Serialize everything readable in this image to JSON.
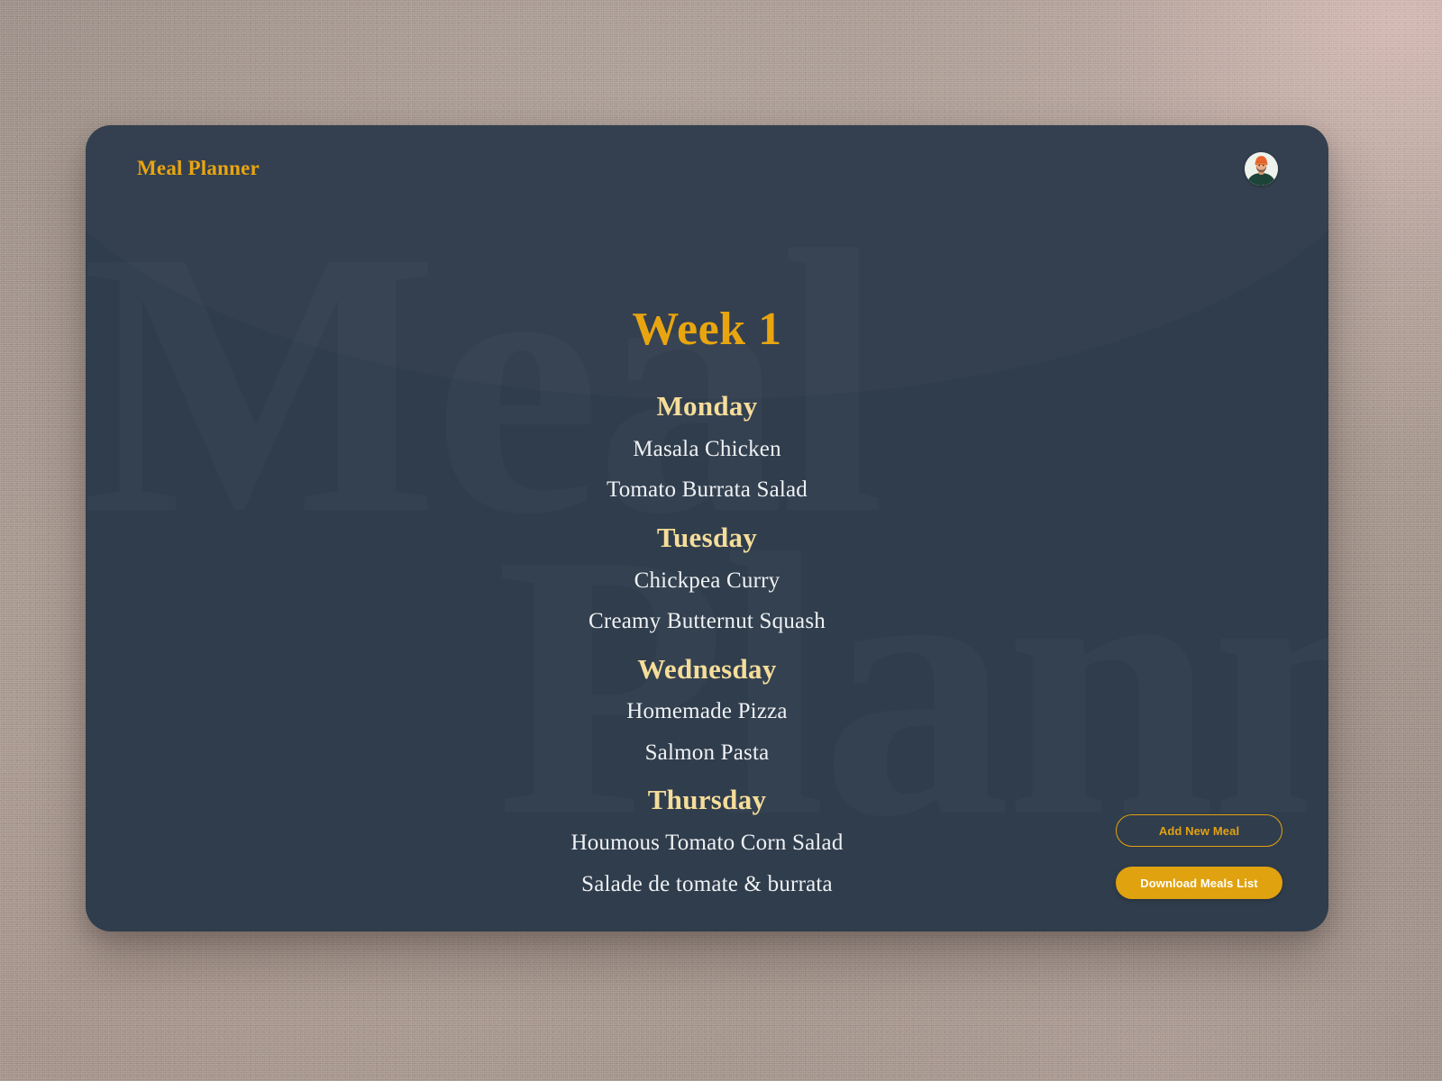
{
  "header": {
    "brand": "Meal Planner",
    "avatar_name": "user-avatar"
  },
  "watermark": {
    "line1": "Meal",
    "line2": "Plann"
  },
  "main": {
    "week_title": "Week 1",
    "days": [
      {
        "name": "Monday",
        "meals": [
          "Masala Chicken",
          "Tomato Burrata Salad"
        ]
      },
      {
        "name": "Tuesday",
        "meals": [
          "Chickpea Curry",
          "Creamy Butternut Squash"
        ]
      },
      {
        "name": "Wednesday",
        "meals": [
          "Homemade Pizza",
          "Salmon Pasta"
        ]
      },
      {
        "name": "Thursday",
        "meals": [
          "Houmous Tomato Corn Salad",
          "Salade de tomate & burrata"
        ]
      }
    ]
  },
  "actions": {
    "add_meal_label": "Add New Meal",
    "download_label": "Download Meals List"
  },
  "colors": {
    "card_background": "#303d4c",
    "page_background": "#a39289",
    "accent_gold": "#e9a510",
    "day_heading": "#f5dd9a",
    "meal_text": "#eef1f4",
    "button_fill": "#e0a20f"
  }
}
